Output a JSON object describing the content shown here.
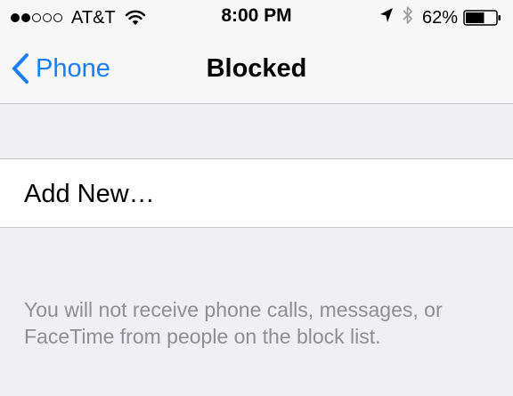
{
  "status_bar": {
    "signal": {
      "filled": 2,
      "total": 5
    },
    "carrier": "AT&T",
    "time": "8:00 PM",
    "battery_percent": "62%",
    "battery_level": 0.62,
    "icons": [
      "wifi-icon",
      "location-icon",
      "bluetooth-icon",
      "battery-icon"
    ]
  },
  "nav": {
    "back_label": "Phone",
    "title": "Blocked"
  },
  "list": {
    "add_new_label": "Add New…"
  },
  "footer": {
    "note": "You will not receive phone calls, messages, or FaceTime from people on the block list."
  },
  "colors": {
    "accent": "#1a7cf4",
    "background": "#efeff4",
    "bar": "#f7f7f7",
    "separator": "#c8c7cc",
    "footer_text": "#8e8e93"
  }
}
